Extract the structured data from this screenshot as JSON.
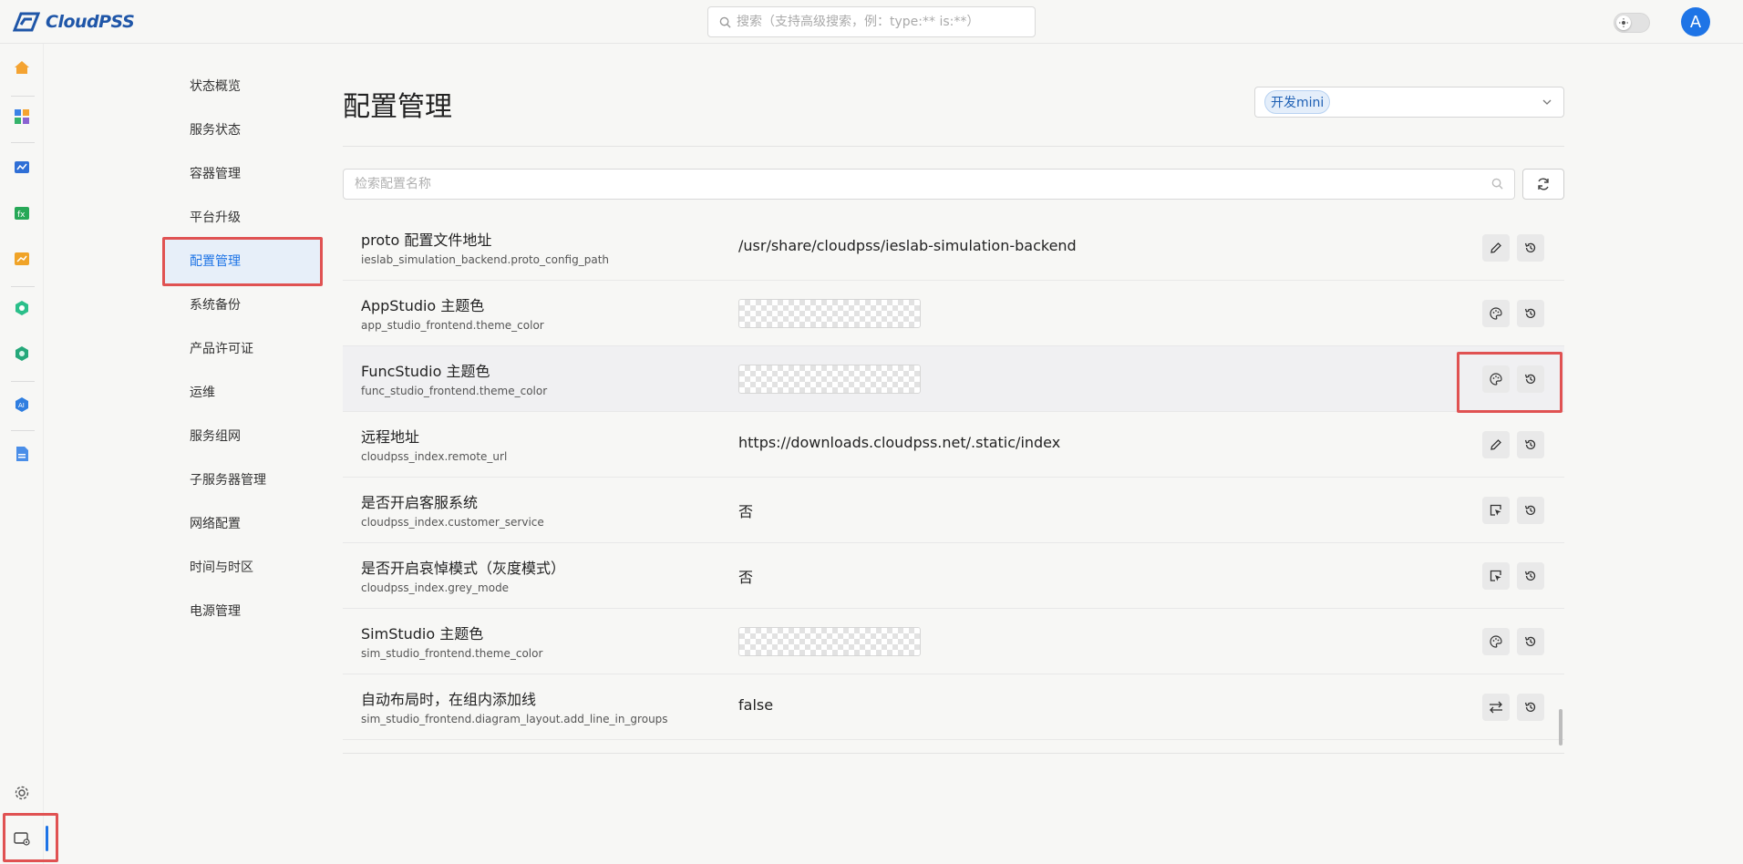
{
  "app": {
    "logo_text": "CloudPSS"
  },
  "header": {
    "search_placeholder": "搜索（支持高级搜索，例：type:** is:**）",
    "avatar_letter": "A"
  },
  "subnav": {
    "items": [
      {
        "label": "状态概览"
      },
      {
        "label": "服务状态"
      },
      {
        "label": "容器管理"
      },
      {
        "label": "平台升级"
      },
      {
        "label": "配置管理"
      },
      {
        "label": "系统备份"
      },
      {
        "label": "产品许可证"
      },
      {
        "label": "运维"
      },
      {
        "label": "服务组网"
      },
      {
        "label": "子服务器管理"
      },
      {
        "label": "网络配置"
      },
      {
        "label": "时间与时区"
      },
      {
        "label": "电源管理"
      }
    ],
    "active_index": 4
  },
  "page": {
    "title": "配置管理",
    "env_value": "开发mini",
    "filter_placeholder": "检索配置名称"
  },
  "config_rows": [
    {
      "label": "proto 配置文件地址",
      "key": "ieslab_simulation_backend.proto_config_path",
      "value": "/usr/share/cloudpss/ieslab-simulation-backend",
      "value_type": "text",
      "action": "edit"
    },
    {
      "label": "AppStudio 主题色",
      "key": "app_studio_frontend.theme_color",
      "value": "",
      "value_type": "color",
      "action": "palette"
    },
    {
      "label": "FuncStudio 主题色",
      "key": "func_studio_frontend.theme_color",
      "value": "",
      "value_type": "color",
      "action": "palette"
    },
    {
      "label": "远程地址",
      "key": "cloudpss_index.remote_url",
      "value": "https://downloads.cloudpss.net/.static/index",
      "value_type": "text",
      "action": "edit"
    },
    {
      "label": "是否开启客服系统",
      "key": "cloudpss_index.customer_service",
      "value": "否",
      "value_type": "text",
      "action": "select"
    },
    {
      "label": "是否开启哀悼模式（灰度模式）",
      "key": "cloudpss_index.grey_mode",
      "value": "否",
      "value_type": "text",
      "action": "select"
    },
    {
      "label": "SimStudio 主题色",
      "key": "sim_studio_frontend.theme_color",
      "value": "",
      "value_type": "color",
      "action": "palette"
    },
    {
      "label": "自动布局时，在组内添加线",
      "key": "sim_studio_frontend.diagram_layout.add_line_in_groups",
      "value": "false",
      "value_type": "text",
      "action": "toggle"
    }
  ],
  "colors": {
    "accent": "#1e74e6",
    "highlight": "#e05252",
    "logo": "#1f56a8"
  }
}
